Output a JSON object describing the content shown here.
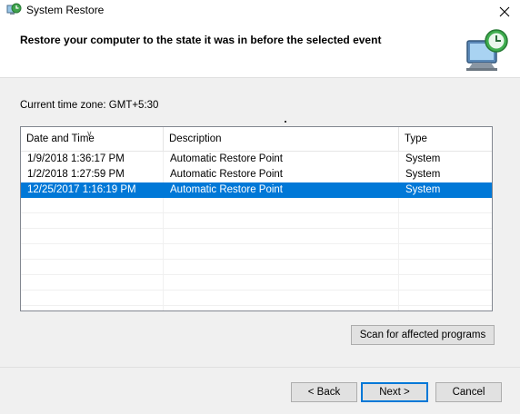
{
  "window": {
    "title": "System Restore",
    "icon": "system-restore-icon",
    "close_glyph": "✕"
  },
  "header": {
    "title": "Restore your computer to the state it was in before the selected event",
    "icon": "system-restore-monitor-icon"
  },
  "timezone_label": "Current time zone: GMT+5:30",
  "restore_points": {
    "columns": [
      "Date and Time",
      "Description",
      "Type"
    ],
    "sort_indicator": "∨",
    "rows": [
      {
        "date": "1/9/2018 1:36:17 PM",
        "description": "Automatic Restore Point",
        "type": "System",
        "selected": false
      },
      {
        "date": "1/2/2018 1:27:59 PM",
        "description": "Automatic Restore Point",
        "type": "System",
        "selected": false
      },
      {
        "date": "12/25/2017 1:16:19 PM",
        "description": "Automatic Restore Point",
        "type": "System",
        "selected": true
      }
    ]
  },
  "buttons": {
    "scan": "Scan for affected programs",
    "back": "< Back",
    "next": "Next >",
    "cancel": "Cancel"
  },
  "colors": {
    "selection": "#0078d7",
    "panel_bg": "#f0f0f0",
    "button_bg": "#e1e1e1"
  }
}
